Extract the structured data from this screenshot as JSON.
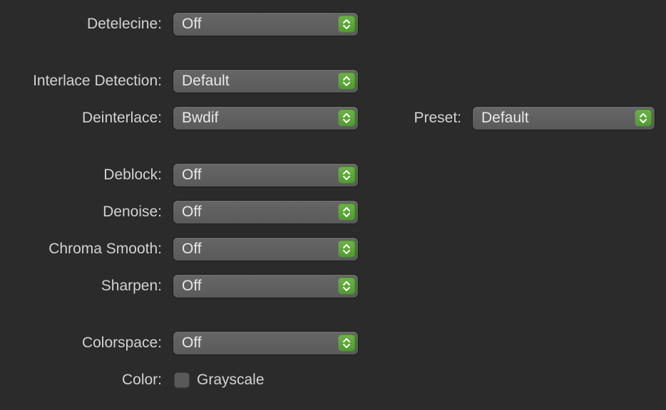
{
  "filters": {
    "detelecine": {
      "label": "Detelecine:",
      "value": "Off"
    },
    "interlace_detection": {
      "label": "Interlace Detection:",
      "value": "Default"
    },
    "deinterlace": {
      "label": "Deinterlace:",
      "value": "Bwdif"
    },
    "preset": {
      "label": "Preset:",
      "value": "Default"
    },
    "deblock": {
      "label": "Deblock:",
      "value": "Off"
    },
    "denoise": {
      "label": "Denoise:",
      "value": "Off"
    },
    "chroma_smooth": {
      "label": "Chroma Smooth:",
      "value": "Off"
    },
    "sharpen": {
      "label": "Sharpen:",
      "value": "Off"
    },
    "colorspace": {
      "label": "Colorspace:",
      "value": "Off"
    },
    "color": {
      "label": "Color:",
      "checkbox_label": "Grayscale",
      "checked": false
    }
  },
  "icons": {
    "popup_stepper": "chevron-up-down-icon"
  },
  "colors": {
    "background": "#2b2b2b",
    "accent": "#5aa83a",
    "popup": "#616161",
    "text": "#d2d2d2"
  }
}
